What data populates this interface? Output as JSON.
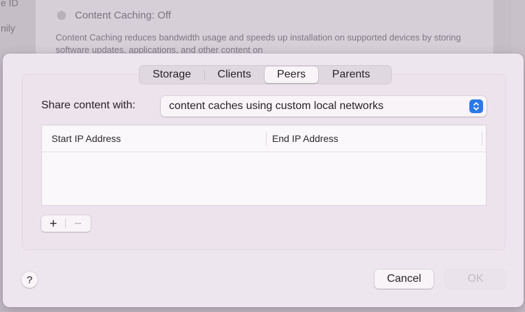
{
  "background": {
    "status_label": "Content Caching: Off",
    "description": "Content Caching reduces bandwidth usage and speeds up installation on supported devices by storing software updates, applications, and other content on",
    "side_labels": [
      "e ID",
      "nily"
    ]
  },
  "tabs": [
    {
      "label": "Storage",
      "selected": false
    },
    {
      "label": "Clients",
      "selected": false
    },
    {
      "label": "Peers",
      "selected": true
    },
    {
      "label": "Parents",
      "selected": false
    }
  ],
  "share": {
    "label": "Share content with:",
    "selected_value": "content caches using custom local networks"
  },
  "table": {
    "columns": [
      "Start IP Address",
      "End IP Address"
    ],
    "rows": []
  },
  "controls": {
    "add_glyph": "+",
    "remove_glyph": "−"
  },
  "footer": {
    "help_glyph": "?",
    "cancel_label": "Cancel",
    "ok_label": "OK",
    "ok_enabled": false
  },
  "colors": {
    "accent": "#2c79e6"
  }
}
